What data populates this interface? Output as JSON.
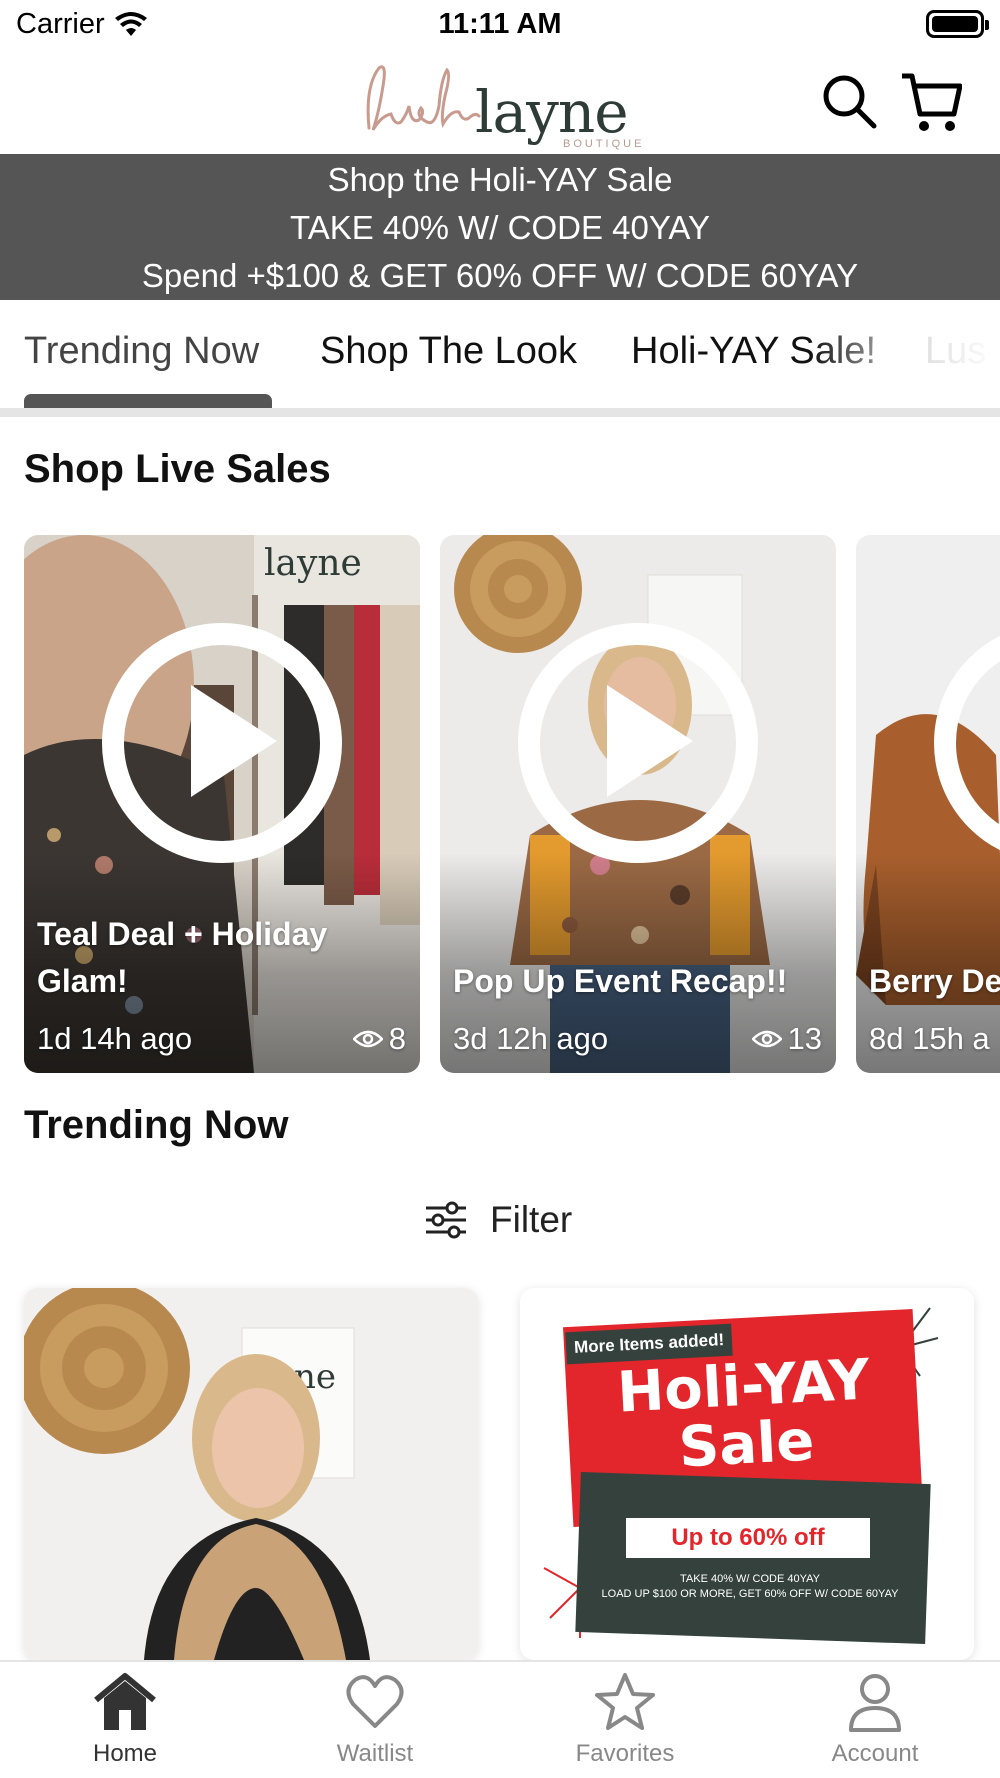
{
  "status_bar": {
    "carrier": "Carrier",
    "time": "11:11 AM"
  },
  "header": {
    "logo_script": "lush",
    "logo_main": "layne",
    "logo_sub": "BOUTIQUE",
    "search_icon": "search-icon",
    "cart_icon": "cart-icon"
  },
  "promo": {
    "line1": "Shop the Holi-YAY Sale",
    "line2": "TAKE 40% W/ CODE 40YAY",
    "line3": "Spend +$100 & GET 60% OFF W/ CODE 60YAY",
    "background": "#555555"
  },
  "tabs": {
    "items": [
      {
        "label": "Trending Now",
        "active": true
      },
      {
        "label": "Shop The Look",
        "active": false
      },
      {
        "label": "Holi-YAY Sale!",
        "active": false
      },
      {
        "label": "Lus",
        "active": false
      }
    ]
  },
  "live_sales": {
    "title": "Shop Live Sales",
    "items": [
      {
        "title": "Teal Deal + Holiday Glam!",
        "time": "1d 14h ago",
        "views": "8"
      },
      {
        "title": "Pop Up Event Recap!!",
        "time": "3d 12h ago",
        "views": "13"
      },
      {
        "title": "Berry De",
        "time": "8d 15h a",
        "views": ""
      }
    ]
  },
  "trending": {
    "title": "Trending Now",
    "filter_label": "Filter",
    "promo_tile": {
      "tag": "More Items added!",
      "title": "Holi-YAY Sale",
      "badge": "Up to 60% off",
      "fine_line1": "TAKE 40% W/ CODE 40YAY",
      "fine_line2": "LOAD UP $100 OR MORE, GET 60% OFF W/ CODE 60YAY"
    }
  },
  "bottom_nav": {
    "items": [
      {
        "label": "Home",
        "icon": "home-icon",
        "active": true
      },
      {
        "label": "Waitlist",
        "icon": "heart-icon",
        "active": false
      },
      {
        "label": "Favorites",
        "icon": "star-icon",
        "active": false
      },
      {
        "label": "Account",
        "icon": "person-icon",
        "active": false
      }
    ]
  },
  "colors": {
    "banner": "#555555",
    "sale_red": "#e3262b",
    "sale_green": "#34413d",
    "logo_dark": "#2f3b37",
    "logo_blush": "#c99a8e"
  }
}
